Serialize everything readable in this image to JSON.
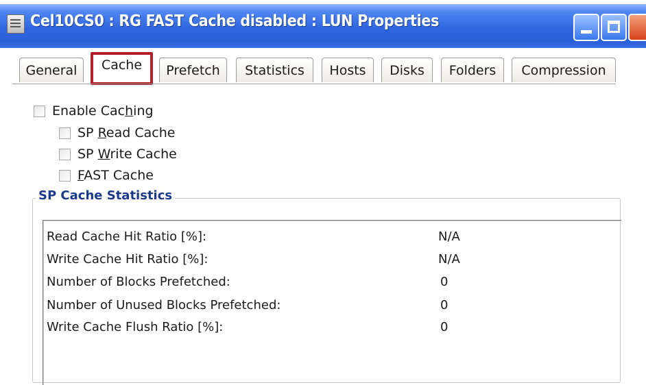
{
  "window": {
    "title": "Cel10CS0 : RG FAST Cache disabled : LUN Properties",
    "buttons": [
      "minimize",
      "maximize",
      "close"
    ]
  },
  "tabs": [
    {
      "label": "General",
      "active": false
    },
    {
      "label": "Cache",
      "active": true
    },
    {
      "label": "Prefetch",
      "active": false
    },
    {
      "label": "Statistics",
      "active": false
    },
    {
      "label": "Hosts",
      "active": false
    },
    {
      "label": "Disks",
      "active": false
    },
    {
      "label": "Folders",
      "active": false
    },
    {
      "label": "Compression",
      "active": false
    }
  ],
  "caching": {
    "enable_caching": {
      "pre": "Enable Cac",
      "mnemonic": "h",
      "post": "ing",
      "checked": false
    },
    "sp_read_cache": {
      "pre": "SP ",
      "mnemonic": "R",
      "post": "ead Cache",
      "checked": false
    },
    "sp_write_cache": {
      "pre": "SP ",
      "mnemonic": "W",
      "post": "rite Cache",
      "checked": false
    },
    "fast_cache": {
      "pre": "",
      "mnemonic": "F",
      "post": "AST Cache",
      "checked": false
    }
  },
  "sp_cache_statistics": {
    "title": "SP Cache Statistics",
    "rows": [
      {
        "label": "Read Cache Hit Ratio [%]:",
        "value": "N/A"
      },
      {
        "label": "Write Cache Hit Ratio [%]:",
        "value": "N/A"
      },
      {
        "label": "Number of Blocks Prefetched:",
        "value": "0"
      },
      {
        "label": "Number of Unused Blocks Prefetched:",
        "value": "0"
      },
      {
        "label": "Write Cache Flush Ratio [%]:",
        "value": "0"
      }
    ]
  },
  "colors": {
    "titlebar": "#2f66e0",
    "active_tab_highlight": "#b3202a",
    "group_title": "#1b3a8b"
  }
}
